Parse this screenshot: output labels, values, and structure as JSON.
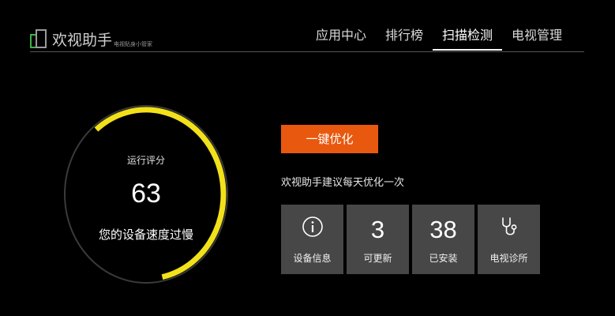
{
  "app": {
    "title": "欢视助手",
    "subtitle": "电视贴身小管家"
  },
  "nav": {
    "tabs": [
      {
        "label": "应用中心"
      },
      {
        "label": "排行榜"
      },
      {
        "label": "扫描检测"
      },
      {
        "label": "电视管理"
      }
    ],
    "active_index": 2
  },
  "gauge": {
    "label": "运行评分",
    "score": "63",
    "score_value": 63,
    "status": "您的设备速度过慢",
    "ring_color": "#3a3a3a",
    "fill_color": "#f2e11a"
  },
  "actions": {
    "optimize_label": "一键优化",
    "tip": "欢视助手建议每天优化一次",
    "accent_color": "#e8580e"
  },
  "tiles": [
    {
      "icon": "info-icon",
      "value": "",
      "label": "设备信息"
    },
    {
      "icon": "",
      "value": "3",
      "label": "可更新"
    },
    {
      "icon": "",
      "value": "38",
      "label": "已安装"
    },
    {
      "icon": "stethoscope-icon",
      "value": "",
      "label": "电视诊所"
    }
  ]
}
